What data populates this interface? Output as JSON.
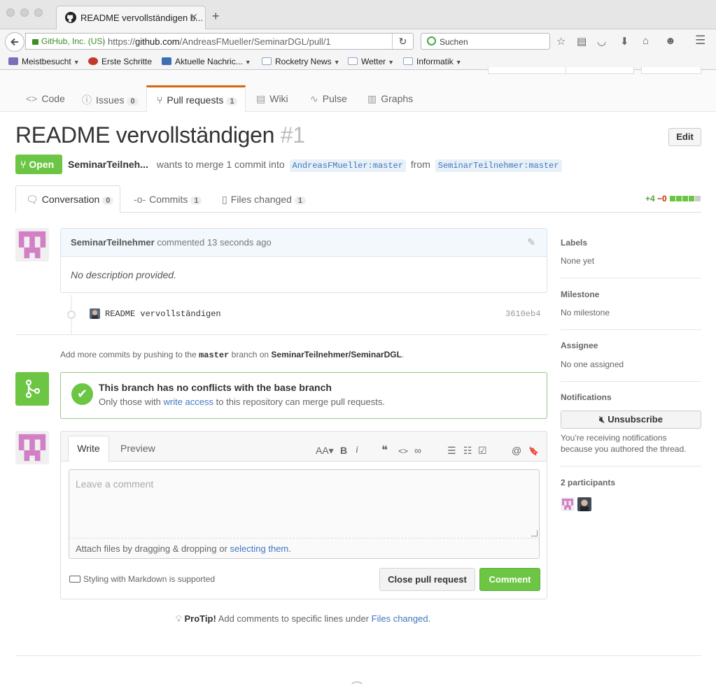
{
  "browser": {
    "tab_title": "README vervollständigen b...",
    "tab_close": "✕",
    "new_tab": "+",
    "url_identity": "GitHub, Inc. (US)",
    "url_prefix": "https://",
    "url_host": "github.com",
    "url_path": "/AndreasFMueller/SeminarDGL/pull/1",
    "search_placeholder": "Suchen",
    "bookmarks": [
      {
        "label": "Meistbesucht",
        "icon": "star-folder-icon",
        "color": "#7b6fb8",
        "dropdown": true
      },
      {
        "label": "Erste Schritte",
        "icon": "firefox-icon",
        "color": "#c0392b",
        "dropdown": false
      },
      {
        "label": "Aktuelle Nachric...",
        "icon": "rss-icon",
        "color": "#3d6fb5",
        "dropdown": true
      },
      {
        "label": "Rocketry News",
        "icon": "folder-icon",
        "color": "#8fa6c4",
        "dropdown": true
      },
      {
        "label": "Wetter",
        "icon": "folder-icon",
        "color": "#8fa6c4",
        "dropdown": true
      },
      {
        "label": "Informatik",
        "icon": "folder-icon",
        "color": "#8fa6c4",
        "dropdown": true
      }
    ]
  },
  "repo_nav": [
    {
      "label": "Code",
      "icon": "<>",
      "count": null
    },
    {
      "label": "Issues",
      "icon": "ⓘ",
      "count": "0"
    },
    {
      "label": "Pull requests",
      "icon": "⑂",
      "count": "1"
    },
    {
      "label": "Wiki",
      "icon": "▤",
      "count": null
    },
    {
      "label": "Pulse",
      "icon": "∿",
      "count": null
    },
    {
      "label": "Graphs",
      "icon": "▥",
      "count": null
    }
  ],
  "pr": {
    "title": "README vervollständigen",
    "number": "#1",
    "edit_label": "Edit",
    "state": "Open",
    "author": "SeminarTeilneh...",
    "merge_text": "wants to merge 1 commit into",
    "base_branch": "AndreasFMueller:master",
    "from_text": "from",
    "head_branch": "SeminarTeilnehmer:master",
    "tabs": [
      {
        "label": "Conversation",
        "count": "0"
      },
      {
        "label": "Commits",
        "count": "1"
      },
      {
        "label": "Files changed",
        "count": "1"
      }
    ],
    "additions": "+4",
    "deletions": "−0"
  },
  "comment": {
    "author": "SeminarTeilnehmer",
    "action": "commented",
    "time": "13 seconds ago",
    "body": "No description provided."
  },
  "commit": {
    "message": "README vervollständigen",
    "sha": "3610eb4"
  },
  "push_hint": {
    "prefix": "Add more commits by pushing to the",
    "branch": "master",
    "middle": "branch on",
    "repo": "SeminarTeilnehmer/SeminarDGL",
    "suffix": "."
  },
  "merge": {
    "title": "This branch has no conflicts with the base branch",
    "sub_prefix": "Only those with",
    "sub_link": "write access",
    "sub_suffix": "to this repository can merge pull requests.",
    "check": "✔"
  },
  "form": {
    "tab_write": "Write",
    "tab_preview": "Preview",
    "placeholder": "Leave a comment",
    "attach_prefix": "Attach files by dragging & dropping or",
    "attach_link": "selecting them",
    "attach_suffix": ".",
    "markdown_hint": "Styling with Markdown is supported",
    "close_label": "Close pull request",
    "comment_label": "Comment",
    "toolbar": [
      "AA▾",
      "B",
      "i",
      "❝",
      "<>",
      "∞",
      "☰",
      "☷",
      "☑",
      "@",
      "🔖"
    ]
  },
  "protip": {
    "label": "ProTip!",
    "text": "Add comments to specific lines under",
    "link": "Files changed",
    "suffix": "."
  },
  "sidebar": {
    "labels_h": "Labels",
    "labels_v": "None yet",
    "milestone_h": "Milestone",
    "milestone_v": "No milestone",
    "assignee_h": "Assignee",
    "assignee_v": "No one assigned",
    "notifications_h": "Notifications",
    "unsubscribe_label": "Unsubscribe",
    "notif_line1": "You’re receiving notifications",
    "notif_line2": "because you authored the thread.",
    "participants_h": "2 participants"
  },
  "colors": {
    "accent_green": "#6cc644",
    "link_blue": "#4078c0",
    "identicon_pink": "#d27fc6",
    "tab_orange": "#d26911"
  }
}
